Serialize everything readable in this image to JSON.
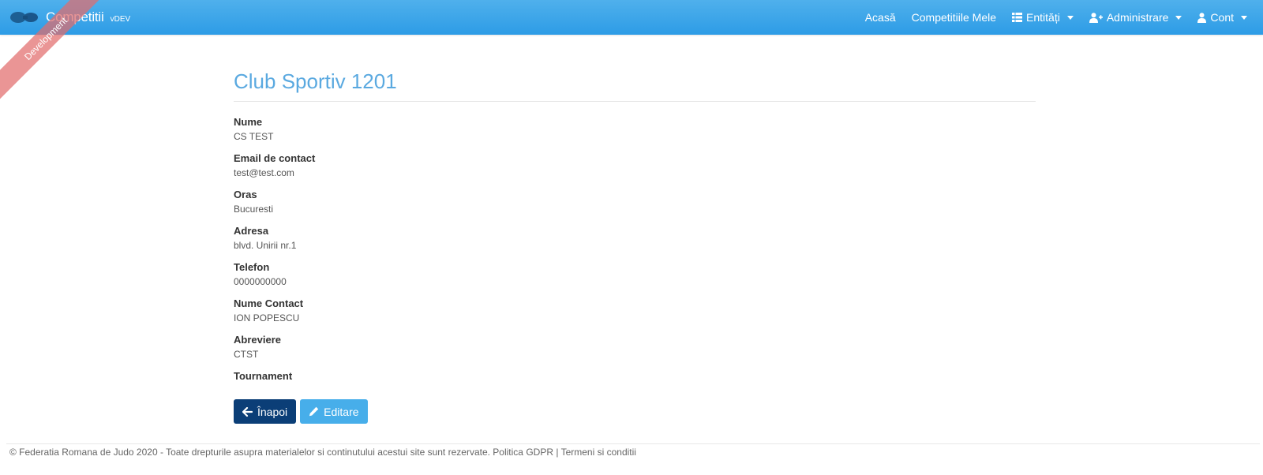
{
  "brand": {
    "name": "Competitii",
    "version": "vDEV",
    "ribbon": "Development"
  },
  "nav": {
    "home": "Acasă",
    "my_competitions": "Competitiile Mele",
    "entities": "Entități",
    "administration": "Administrare",
    "account": "Cont"
  },
  "page": {
    "title": "Club Sportiv 1201"
  },
  "fields": [
    {
      "label": "Nume",
      "value": "CS TEST"
    },
    {
      "label": "Email de contact",
      "value": "test@test.com"
    },
    {
      "label": "Oras",
      "value": "Bucuresti"
    },
    {
      "label": "Adresa",
      "value": "blvd. Unirii nr.1"
    },
    {
      "label": "Telefon",
      "value": "0000000000"
    },
    {
      "label": "Nume Contact",
      "value": "ION POPESCU"
    },
    {
      "label": "Abreviere",
      "value": "CTST"
    },
    {
      "label": "Tournament",
      "value": ""
    }
  ],
  "buttons": {
    "back": "Înapoi",
    "edit": "Editare"
  },
  "footer": {
    "copyright": "© Federatia Romana de Judo 2020 - Toate drepturile asupra materialelor si continutului acestui site sunt rezervate.",
    "gdpr": "Politica GDPR",
    "separator": "|",
    "terms": "Termeni si conditii"
  },
  "colors": {
    "navbar": "#2d9ce6",
    "title": "#5aa9e0",
    "back_button": "#0b3e77",
    "edit_button": "#47aeea",
    "ribbon": "#e26c6c"
  },
  "icons": {
    "logo": "judo-logo-icon",
    "entities": "table-icon",
    "administration": "user-plus-icon",
    "account": "user-icon",
    "back": "arrow-left-icon",
    "edit": "pencil-icon"
  }
}
